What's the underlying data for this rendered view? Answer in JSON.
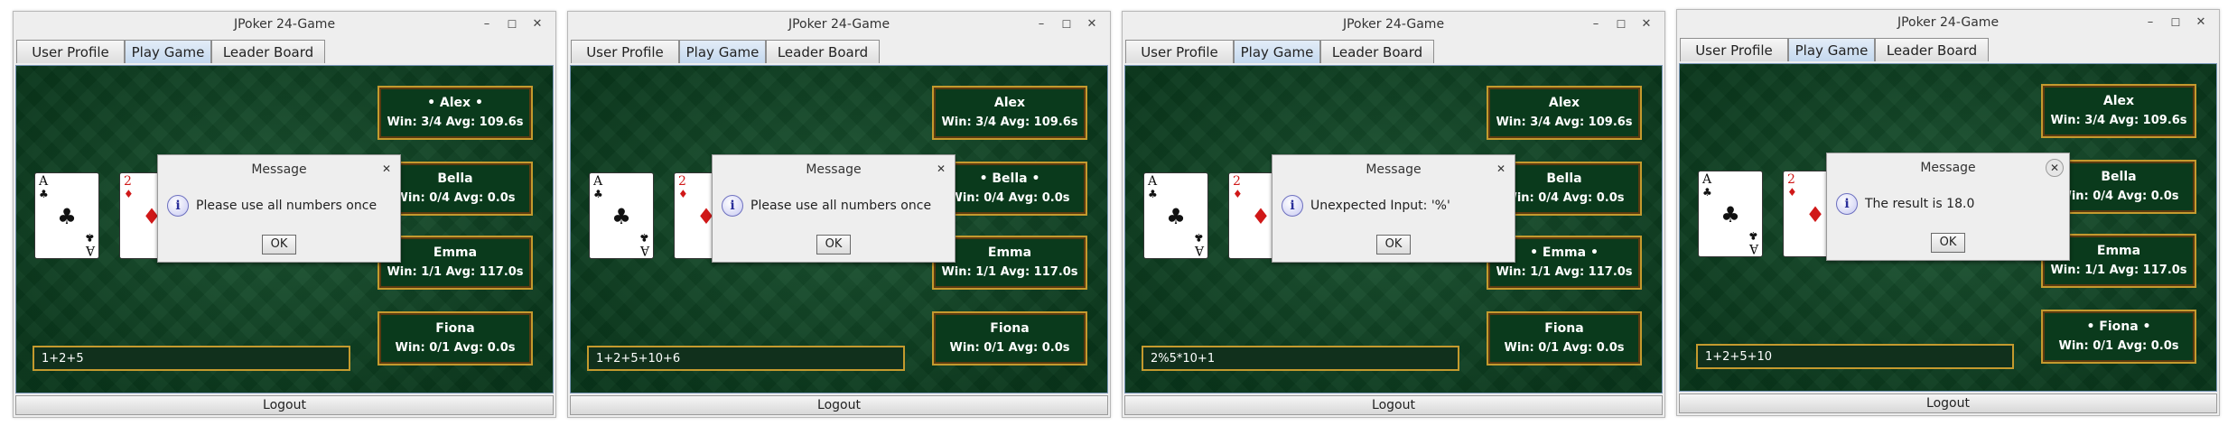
{
  "windows": [
    {
      "title": "JPoker 24-Game",
      "controls": {
        "minimize": "–",
        "maximize": "☐",
        "close": "✕"
      },
      "tabs": [
        "User Profile",
        "Play Game",
        "Leader Board"
      ],
      "active_tab": "Play Game",
      "cards": [
        {
          "rank": "A",
          "suit": "♣",
          "color": "black"
        },
        {
          "rank": "2",
          "suit": "♦",
          "color": "red"
        }
      ],
      "players": [
        {
          "name": "• Alex •",
          "stats": "Win: 3/4 Avg: 109.6s"
        },
        {
          "name": "Bella",
          "stats": "Win: 0/4 Avg: 0.0s"
        },
        {
          "name": "Emma",
          "stats": "Win: 1/1 Avg: 117.0s"
        },
        {
          "name": "Fiona",
          "stats": "Win: 0/1 Avg: 0.0s"
        }
      ],
      "expression": "1+2+5",
      "dialog": {
        "title": "Message",
        "message": "Please use all numbers once",
        "ok": "OK",
        "close": "✕"
      },
      "logout": "Logout"
    },
    {
      "title": "JPoker 24-Game",
      "controls": {
        "minimize": "–",
        "maximize": "☐",
        "close": "✕"
      },
      "tabs": [
        "User Profile",
        "Play Game",
        "Leader Board"
      ],
      "active_tab": "Play Game",
      "cards": [
        {
          "rank": "A",
          "suit": "♣",
          "color": "black"
        },
        {
          "rank": "2",
          "suit": "♦",
          "color": "red"
        }
      ],
      "players": [
        {
          "name": "Alex",
          "stats": "Win: 3/4 Avg: 109.6s"
        },
        {
          "name": "• Bella •",
          "stats": "Win: 0/4 Avg: 0.0s"
        },
        {
          "name": "Emma",
          "stats": "Win: 1/1 Avg: 117.0s"
        },
        {
          "name": "Fiona",
          "stats": "Win: 0/1 Avg: 0.0s"
        }
      ],
      "expression": "1+2+5+10+6",
      "dialog": {
        "title": "Message",
        "message": "Please use all numbers once",
        "ok": "OK",
        "close": "✕"
      },
      "logout": "Logout"
    },
    {
      "title": "JPoker 24-Game",
      "controls": {
        "minimize": "–",
        "maximize": "☐",
        "close": "✕"
      },
      "tabs": [
        "User Profile",
        "Play Game",
        "Leader Board"
      ],
      "active_tab": "Play Game",
      "cards": [
        {
          "rank": "A",
          "suit": "♣",
          "color": "black"
        },
        {
          "rank": "2",
          "suit": "♦",
          "color": "red"
        }
      ],
      "players": [
        {
          "name": "Alex",
          "stats": "Win: 3/4 Avg: 109.6s"
        },
        {
          "name": "Bella",
          "stats": "Win: 0/4 Avg: 0.0s"
        },
        {
          "name": "• Emma •",
          "stats": "Win: 1/1 Avg: 117.0s"
        },
        {
          "name": "Fiona",
          "stats": "Win: 0/1 Avg: 0.0s"
        }
      ],
      "expression": "2%5*10+1",
      "dialog": {
        "title": "Message",
        "message": "Unexpected Input: '%'",
        "ok": "OK",
        "close": "✕"
      },
      "logout": "Logout"
    },
    {
      "title": "JPoker 24-Game",
      "controls": {
        "minimize": "–",
        "maximize": "☐",
        "close": "✕"
      },
      "tabs": [
        "User Profile",
        "Play Game",
        "Leader Board"
      ],
      "active_tab": "Play Game",
      "cards": [
        {
          "rank": "A",
          "suit": "♣",
          "color": "black"
        },
        {
          "rank": "2",
          "suit": "♦",
          "color": "red"
        }
      ],
      "players": [
        {
          "name": "Alex",
          "stats": "Win: 3/4 Avg: 109.6s"
        },
        {
          "name": "Bella",
          "stats": "Win: 0/4 Avg: 0.0s"
        },
        {
          "name": "Emma",
          "stats": "Win: 1/1 Avg: 117.0s"
        },
        {
          "name": "• Fiona •",
          "stats": "Win: 0/1 Avg: 0.0s"
        }
      ],
      "expression": "1+2+5+10",
      "dialog": {
        "title": "Message",
        "message": "The result is 18.0",
        "ok": "OK",
        "close": "✕"
      },
      "logout": "Logout"
    }
  ]
}
